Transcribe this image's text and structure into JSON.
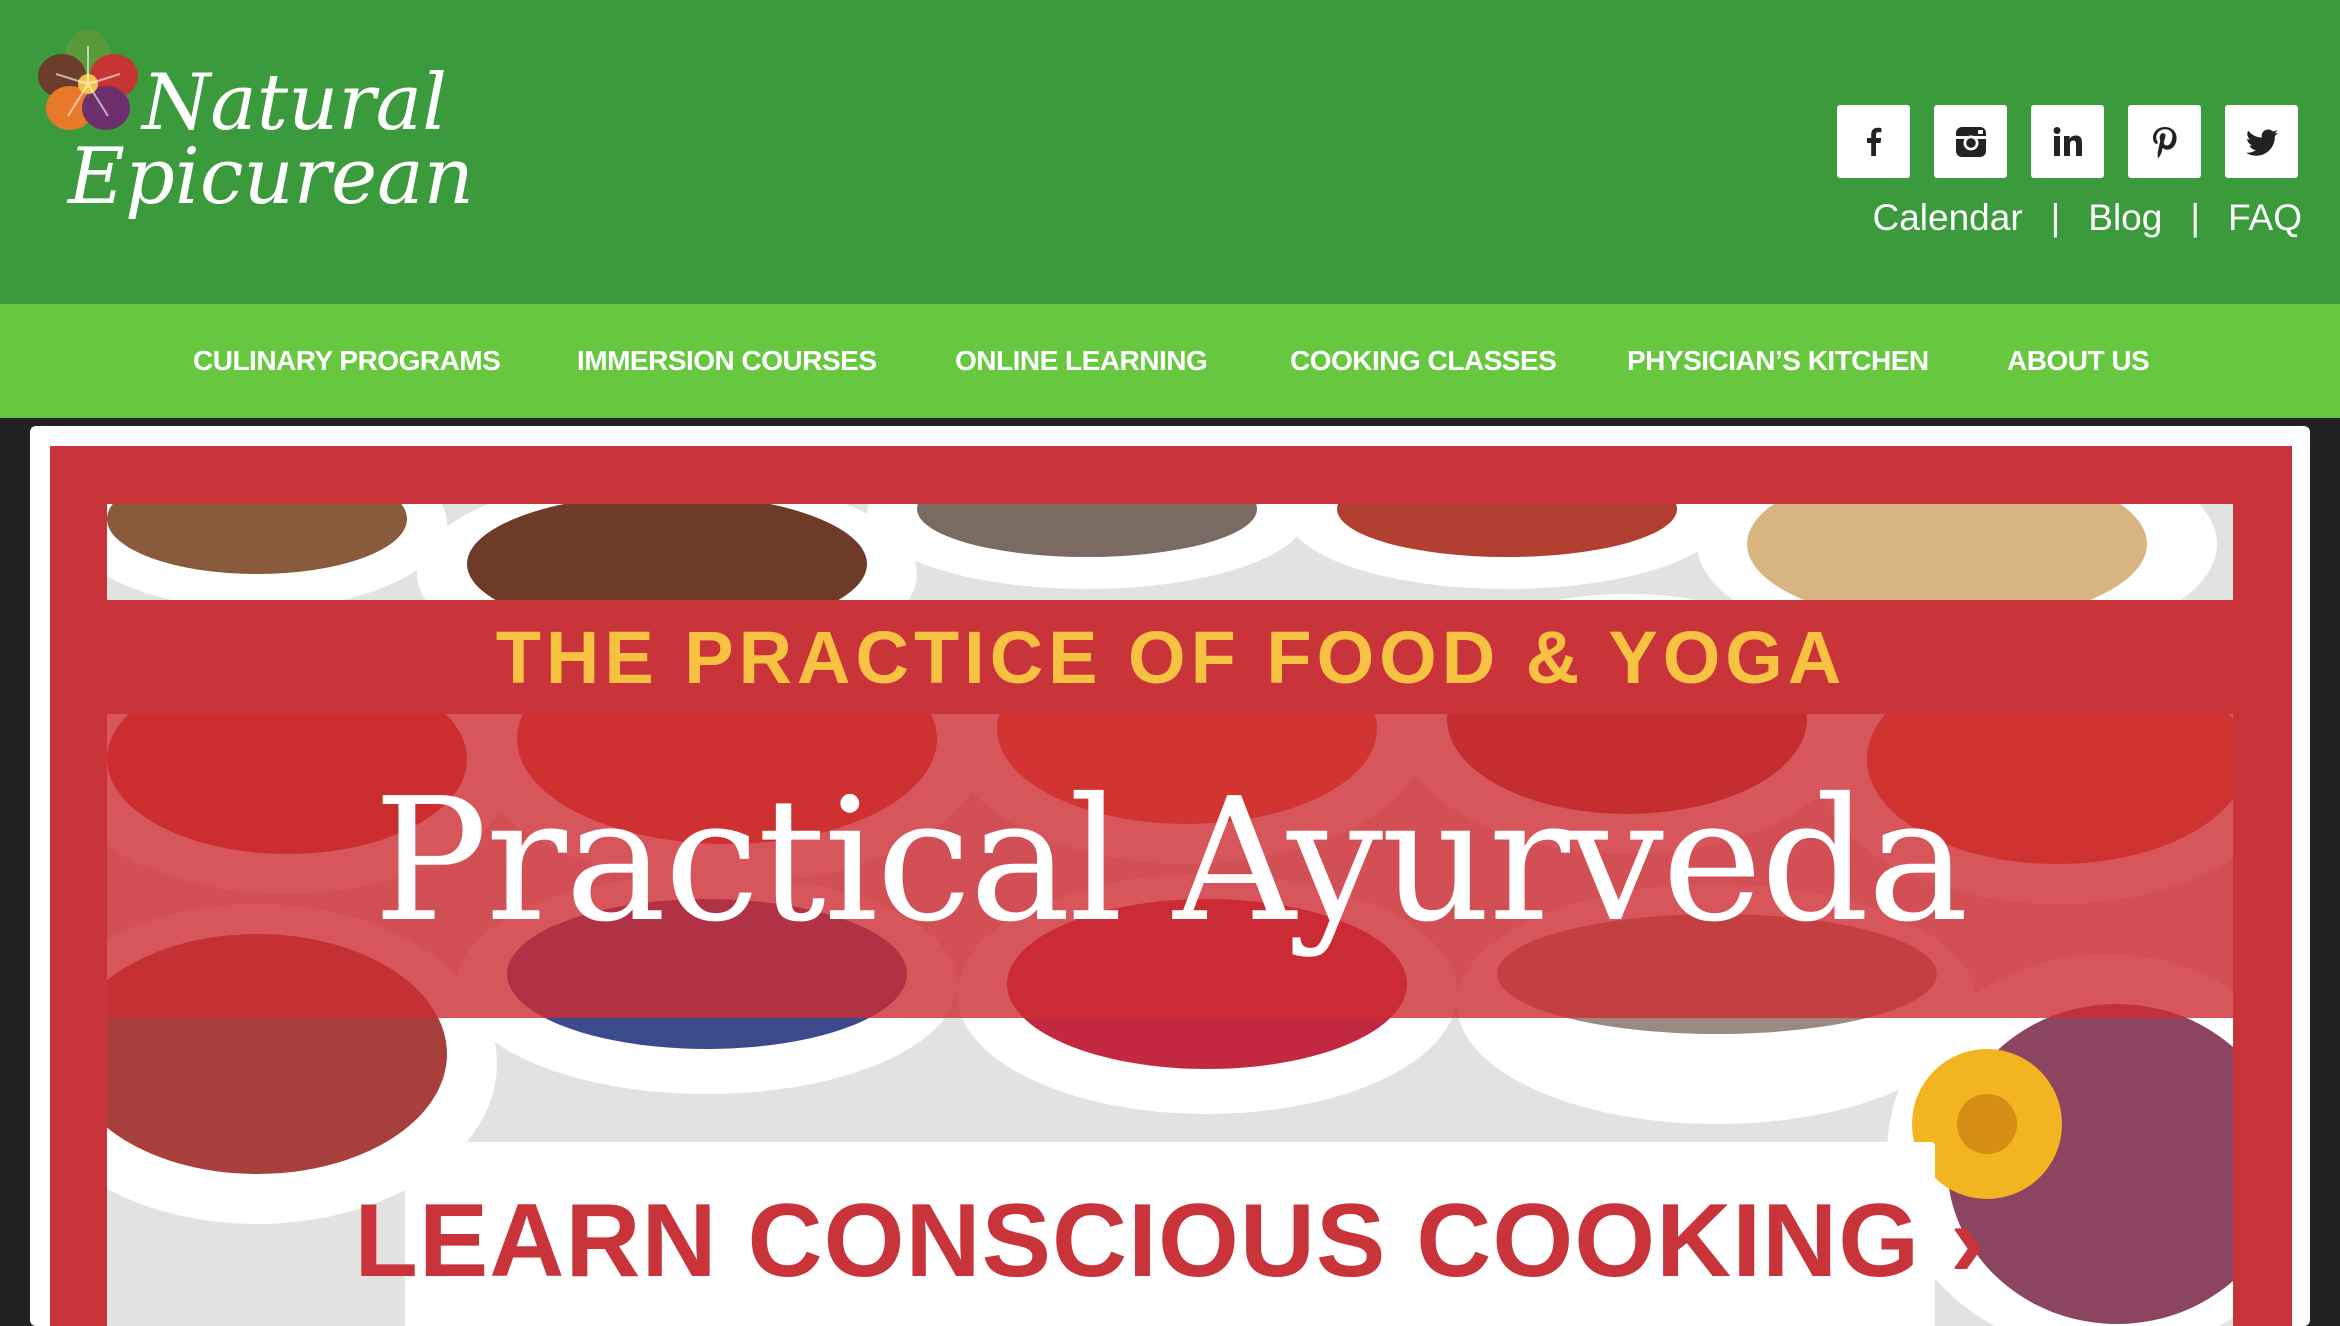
{
  "brand": {
    "line1": "Natural",
    "line2": "Epicurean",
    "colors": {
      "header": "#3a9a3c",
      "nav": "#67c840",
      "banner_red": "#c9333a",
      "accent_yellow": "#f7c242"
    }
  },
  "social": [
    {
      "name": "facebook",
      "icon": "facebook-icon"
    },
    {
      "name": "instagram",
      "icon": "instagram-icon"
    },
    {
      "name": "linkedin",
      "icon": "linkedin-icon"
    },
    {
      "name": "pinterest",
      "icon": "pinterest-icon"
    },
    {
      "name": "twitter",
      "icon": "twitter-icon"
    }
  ],
  "top_links": {
    "calendar": "Calendar",
    "blog": "Blog",
    "faq": "FAQ",
    "separator": "|"
  },
  "nav": [
    "CULINARY PROGRAMS",
    "IMMERSION COURSES",
    "ONLINE LEARNING",
    "COOKING CLASSES",
    "PHYSICIAN’S KITCHEN",
    "ABOUT US"
  ],
  "banner": {
    "eyebrow": "THE PRACTICE OF FOOD & YOGA",
    "title": "Practical Ayurveda",
    "cta": "LEARN CONSCIOUS COOKING ›"
  }
}
